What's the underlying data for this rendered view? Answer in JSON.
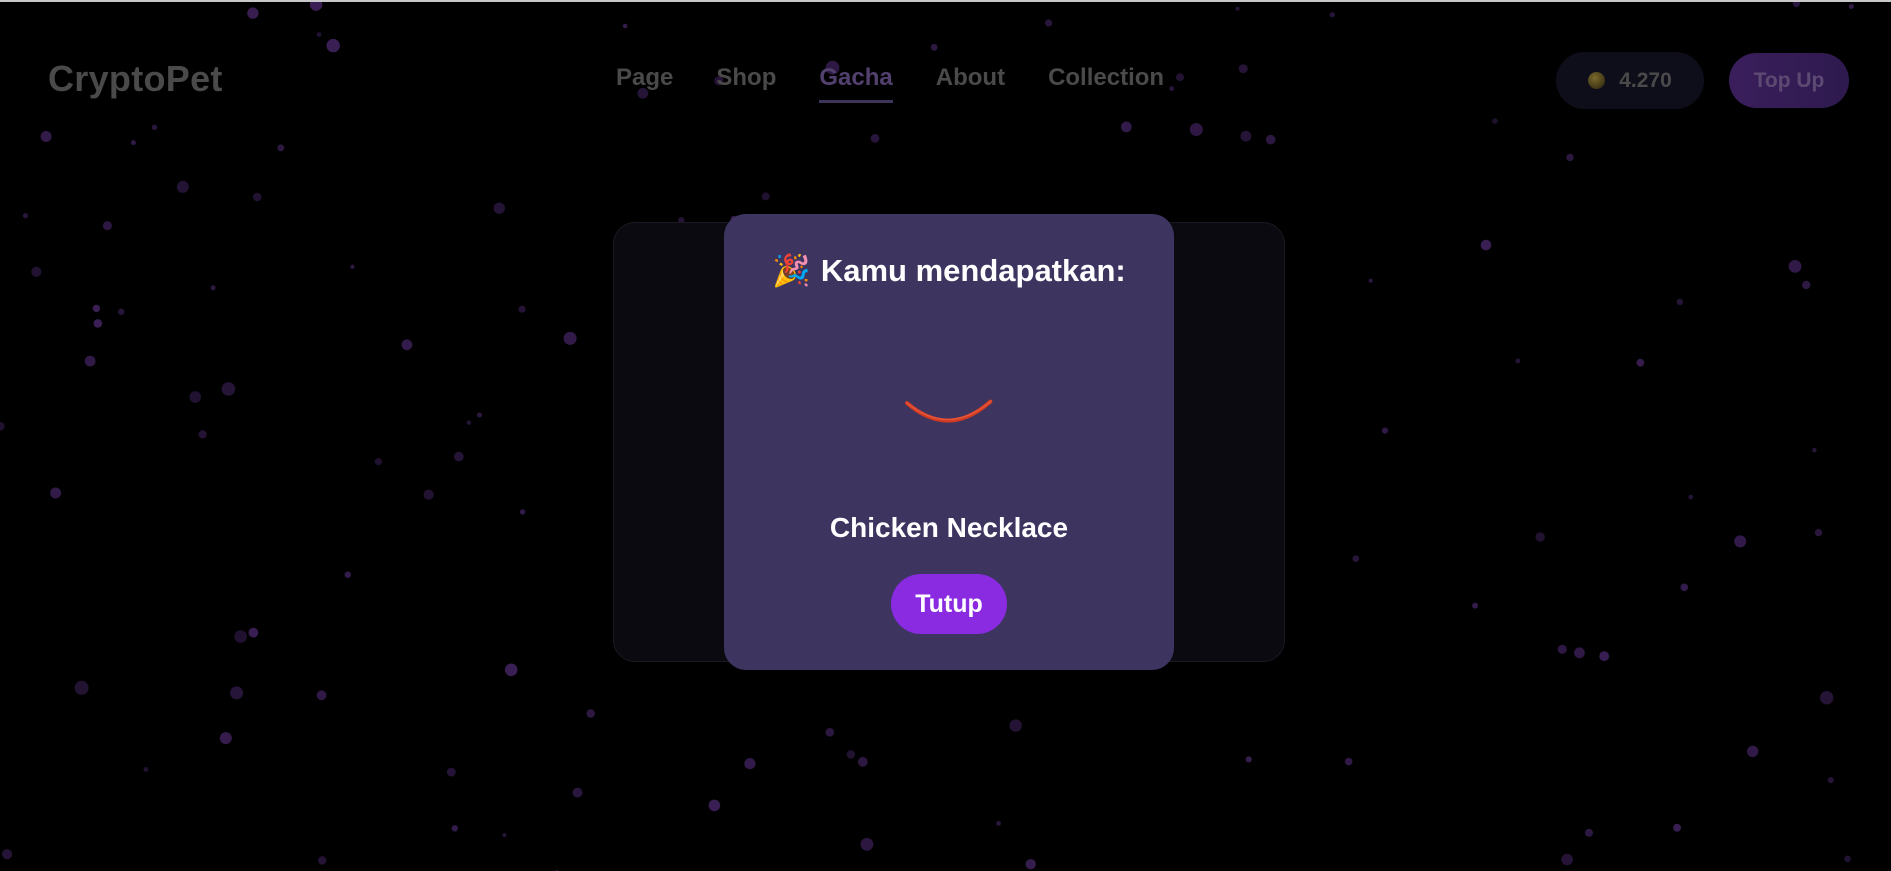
{
  "header": {
    "logo": "CryptoPet",
    "nav": [
      {
        "label": "Page",
        "active": false
      },
      {
        "label": "Shop",
        "active": false
      },
      {
        "label": "Gacha",
        "active": true
      },
      {
        "label": "About",
        "active": false
      },
      {
        "label": "Collection",
        "active": false
      }
    ],
    "balance": "4.270",
    "coin_icon": "coin-icon",
    "topup_label": "Top Up"
  },
  "modal": {
    "title_emoji": "🎉",
    "title": "Kamu mendapatkan:",
    "item_icon": "necklace-icon",
    "item_name": "Chicken Necklace",
    "close_label": "Tutup"
  },
  "colors": {
    "background": "#000000",
    "modal_bg": "#3d3560",
    "button_purple": "#8a2be2",
    "particle": "#3a1f55",
    "necklace_red": "#d33a1f"
  }
}
